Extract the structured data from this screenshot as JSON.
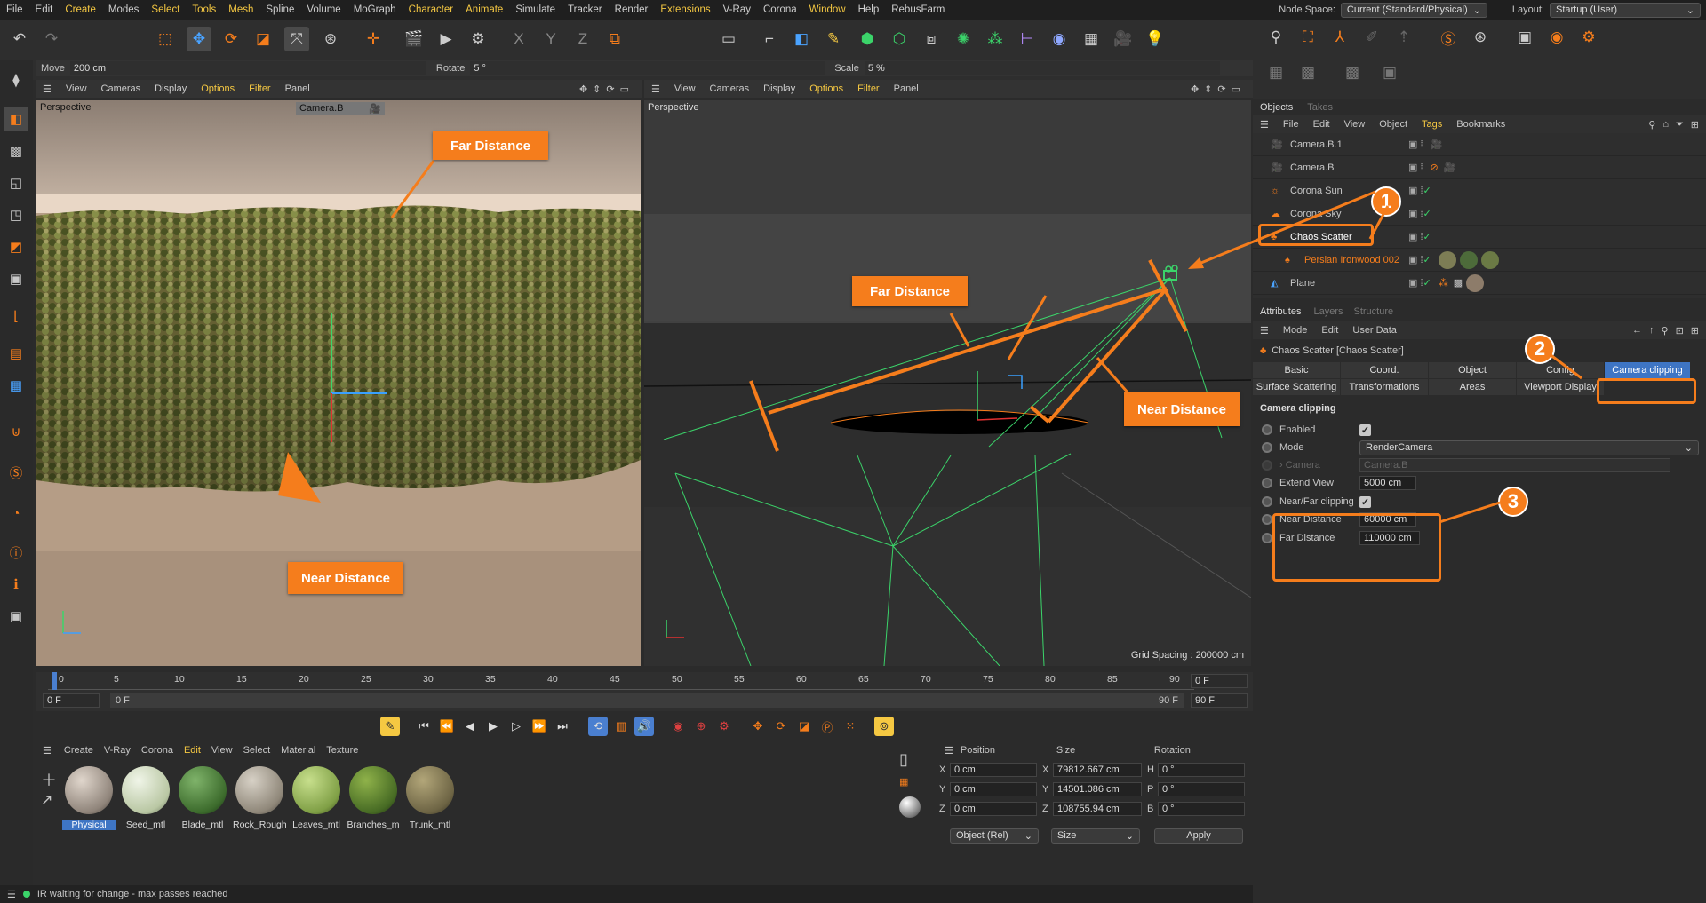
{
  "menu": [
    "File",
    "Edit",
    "Create",
    "Modes",
    "Select",
    "Tools",
    "Mesh",
    "Spline",
    "Volume",
    "MoGraph",
    "Character",
    "Animate",
    "Simulate",
    "Tracker",
    "Render",
    "Extensions",
    "V-Ray",
    "Corona",
    "Window",
    "Help",
    "RebusFarm"
  ],
  "menu_highlight": [
    "Create",
    "Select",
    "Tools",
    "Mesh",
    "Character",
    "Animate",
    "Extensions",
    "Window"
  ],
  "node_space": {
    "label": "Node Space:",
    "value": "Current (Standard/Physical)"
  },
  "layout": {
    "label": "Layout:",
    "value": "Startup (User)"
  },
  "coords": {
    "move_label": "Move",
    "move_value": "200 cm",
    "rotate_label": "Rotate",
    "rotate_value": "5 °",
    "scale_label": "Scale",
    "scale_value": "5 %"
  },
  "viewport_menu": [
    "View",
    "Cameras",
    "Display",
    "Options",
    "Filter",
    "Panel"
  ],
  "viewport_left": {
    "name": "Perspective",
    "camera": "Camera.B"
  },
  "viewport_right": {
    "name": "Perspective",
    "grid": "Grid Spacing : 200000 cm"
  },
  "callouts": {
    "far": "Far Distance",
    "near": "Near Distance",
    "b1": "1",
    "b2": "2",
    "b3": "3"
  },
  "objects_tabs": {
    "objects": "Objects",
    "takes": "Takes"
  },
  "objects_menu": [
    "File",
    "Edit",
    "View",
    "Object",
    "Tags",
    "Bookmarks"
  ],
  "objects": [
    "Camera.B.1",
    "Camera.B",
    "Corona Sun",
    "Corona Sky",
    "Chaos Scatter",
    "Persian Ironwood 002",
    "Plane"
  ],
  "attr_tabs": {
    "attributes": "Attributes",
    "layers": "Layers",
    "structure": "Structure"
  },
  "attr_menu": [
    "Mode",
    "Edit",
    "User Data"
  ],
  "attr_title": "Chaos Scatter [Chaos Scatter]",
  "attr_buttons": [
    "Basic",
    "Coord.",
    "Object",
    "Config",
    "Camera clipping",
    "Surface Scattering",
    "Transformations",
    "Areas",
    "Viewport Display"
  ],
  "camera_clipping": {
    "section": "Camera clipping",
    "enabled": "Enabled",
    "mode_label": "Mode",
    "mode_value": "RenderCamera",
    "camera_label": "Camera",
    "camera_value": "Camera.B",
    "extend_label": "Extend View",
    "extend_value": "5000 cm",
    "nearfar_label": "Near/Far clipping",
    "near_label": "Near Distance",
    "near_value": "60000 cm",
    "far_label": "Far Distance",
    "far_value": "110000 cm"
  },
  "timeline": {
    "ticks": [
      "0",
      "5",
      "10",
      "15",
      "20",
      "25",
      "30",
      "35",
      "40",
      "45",
      "50",
      "55",
      "60",
      "65",
      "70",
      "75",
      "80",
      "85",
      "90"
    ],
    "frame_now": "0 F",
    "start": "0 F",
    "range_start": "0 F",
    "range_end": "90 F",
    "end": "90 F"
  },
  "mat_menu": [
    "Create",
    "V-Ray",
    "Corona",
    "Edit",
    "View",
    "Select",
    "Material",
    "Texture"
  ],
  "materials": [
    "Physical",
    "Seed_mtl",
    "Blade_mtl",
    "Rock_Rough",
    "Leaves_mtl",
    "Branches_m",
    "Trunk_mtl"
  ],
  "coord_mgr": {
    "headers": [
      "Position",
      "Size",
      "Rotation"
    ],
    "x": {
      "axis": "X",
      "pos": "0 cm",
      "size_axis": "X",
      "size": "79812.667 cm",
      "rot_axis": "H",
      "rot": "0 °"
    },
    "y": {
      "axis": "Y",
      "pos": "0 cm",
      "size_axis": "Y",
      "size": "14501.086 cm",
      "rot_axis": "P",
      "rot": "0 °"
    },
    "z": {
      "axis": "Z",
      "pos": "0 cm",
      "size_axis": "Z",
      "size": "108755.94 cm",
      "rot_axis": "B",
      "rot": "0 °"
    },
    "mode": "Object (Rel)",
    "size_mode": "Size",
    "apply": "Apply"
  },
  "status": "IR waiting for change - max passes reached",
  "colors": {
    "accent": "#f57d1c",
    "highlight_text": "#f5c842",
    "green_camera": "#3bd46a"
  }
}
